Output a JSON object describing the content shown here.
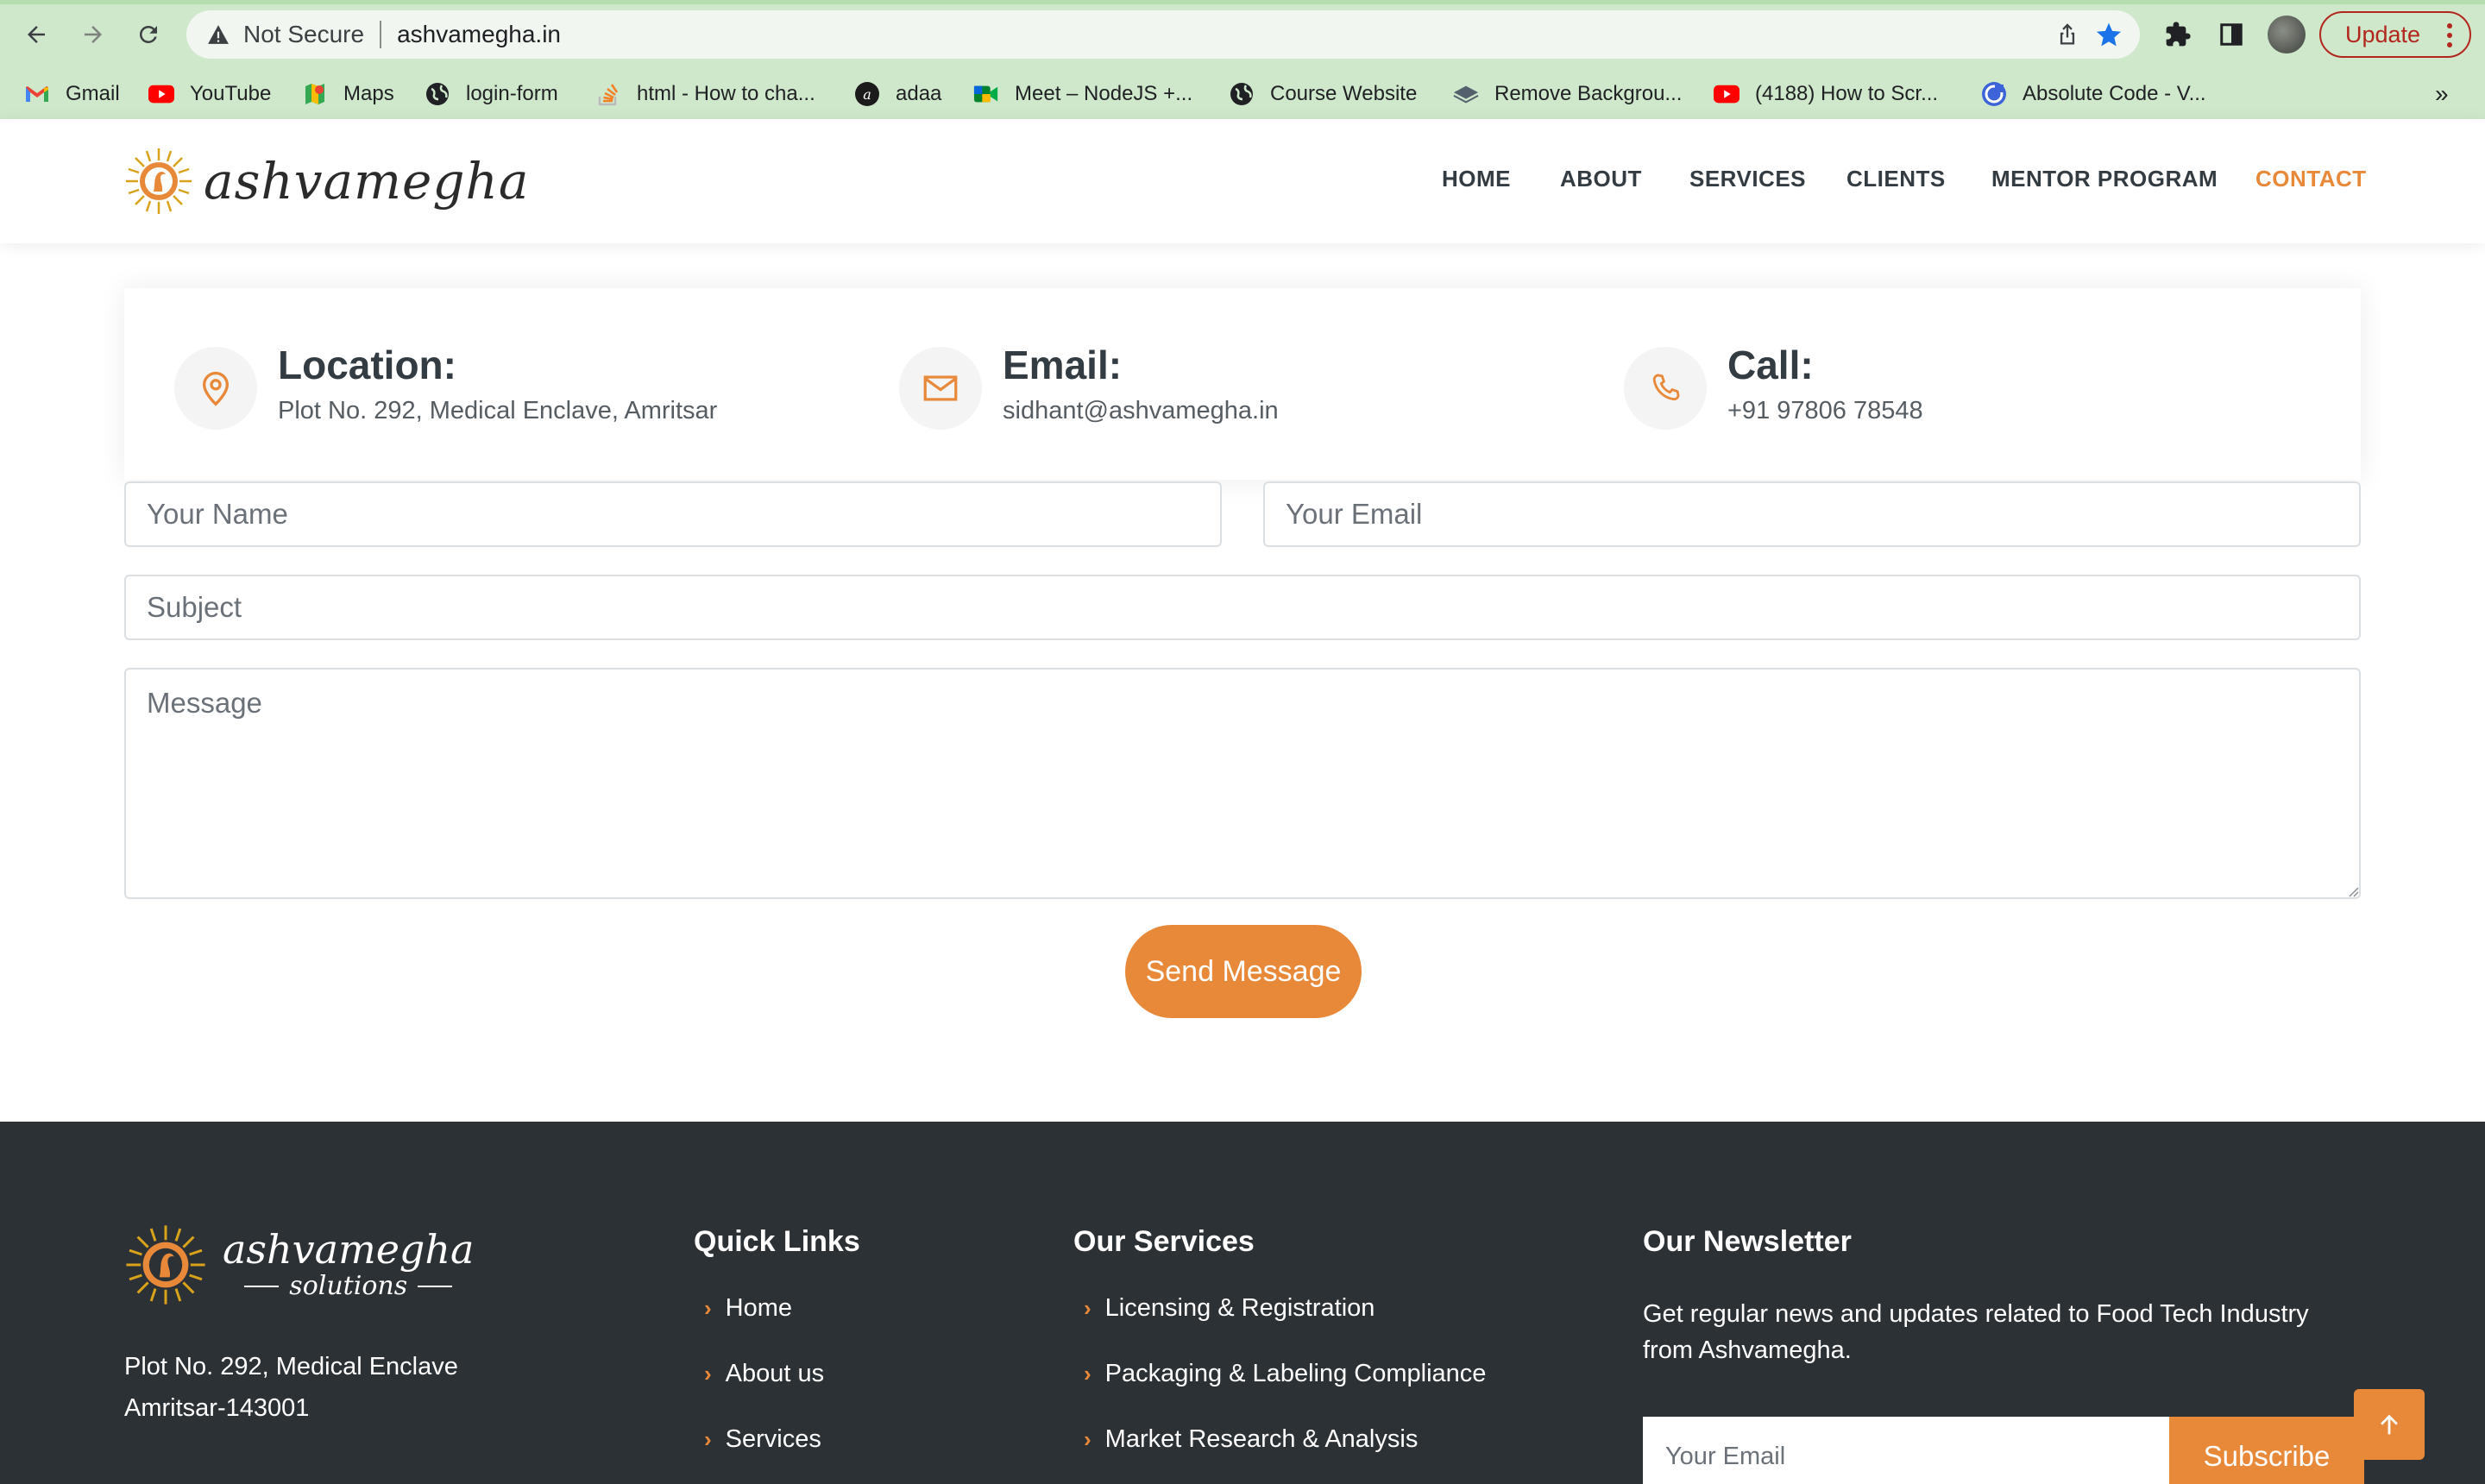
{
  "browser": {
    "not_secure": "Not Secure",
    "url": "ashvamegha.in",
    "update_label": "Update",
    "bookmarks": [
      {
        "label": "Gmail",
        "icon": "gmail-icon"
      },
      {
        "label": "YouTube",
        "icon": "youtube-icon"
      },
      {
        "label": "Maps",
        "icon": "maps-icon"
      },
      {
        "label": "login-form",
        "icon": "globe-icon"
      },
      {
        "label": "html - How to cha...",
        "icon": "stackoverflow-icon"
      },
      {
        "label": "adaa",
        "icon": "adaa-icon"
      },
      {
        "label": "Meet – NodeJS +...",
        "icon": "meet-icon"
      },
      {
        "label": "Course Website",
        "icon": "globe-icon"
      },
      {
        "label": "Remove Backgrou...",
        "icon": "removebg-icon"
      },
      {
        "label": "(4188) How to Scr...",
        "icon": "youtube-icon"
      },
      {
        "label": "Absolute Code - V...",
        "icon": "absolute-code-icon"
      }
    ],
    "more": "»"
  },
  "site": {
    "logo_text": "ashvamegha",
    "nav": [
      "HOME",
      "ABOUT",
      "SERVICES",
      "CLIENTS",
      "MENTOR PROGRAM",
      "CONTACT"
    ],
    "active_nav": "CONTACT"
  },
  "contact_info": {
    "location": {
      "title": "Location:",
      "value": "Plot No. 292, Medical Enclave, Amritsar"
    },
    "email": {
      "title": "Email:",
      "value": "sidhant@ashvamegha.in"
    },
    "call": {
      "title": "Call:",
      "value": "+91 97806 78548"
    }
  },
  "form": {
    "name_placeholder": "Your Name",
    "email_placeholder": "Your Email",
    "subject_placeholder": "Subject",
    "message_placeholder": "Message",
    "send_label": "Send Message"
  },
  "footer": {
    "logo_line1": "ashvamegha",
    "logo_line2": "solutions",
    "address_line1": "Plot No. 292, Medical Enclave",
    "address_line2": "Amritsar-143001",
    "quick_links_title": "Quick Links",
    "quick_links": [
      "Home",
      "About us",
      "Services"
    ],
    "services_title": "Our Services",
    "services": [
      "Licensing & Registration",
      "Packaging & Labeling Compliance",
      "Market Research & Analysis"
    ],
    "newsletter_title": "Our Newsletter",
    "newsletter_text": "Get regular news and updates related to Food Tech Industry from Ashvamegha.",
    "newsletter_placeholder": "Your Email",
    "subscribe_label": "Subscribe"
  },
  "colors": {
    "accent": "#e8893a",
    "footer_bg": "#2c3135",
    "chrome_bg": "#cfe8cb",
    "heading": "#333c42"
  }
}
